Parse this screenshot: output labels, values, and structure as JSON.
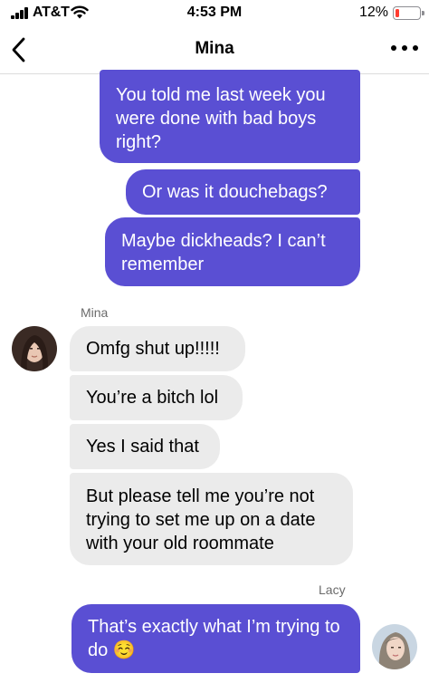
{
  "status_bar": {
    "carrier": "AT&T",
    "time": "4:53 PM",
    "battery_percent": "12%",
    "battery_level": 0.12,
    "battery_color": "#ff3b30"
  },
  "nav": {
    "title": "Mina",
    "back_icon": "chevron-left-icon",
    "more_icon": "more-horizontal-icon"
  },
  "colors": {
    "outgoing_bubble": "#5a4fd3",
    "incoming_bubble": "#ebebeb"
  },
  "messages": {
    "out_1": "You told me last week you were done with bad boys right?",
    "out_2": "Or was it douchebags?",
    "out_3": "Maybe dickheads? I can’t remember",
    "mina_label": "Mina",
    "in_1": "Omfg shut up!!!!!",
    "in_2": "You’re a bitch lol",
    "in_3": "Yes I said that",
    "in_4": "But please tell me you’re not trying to set me up on a date with your old roommate",
    "lacy_label": "Lacy",
    "out_4": "That’s exactly what I’m trying to do ☺️"
  }
}
